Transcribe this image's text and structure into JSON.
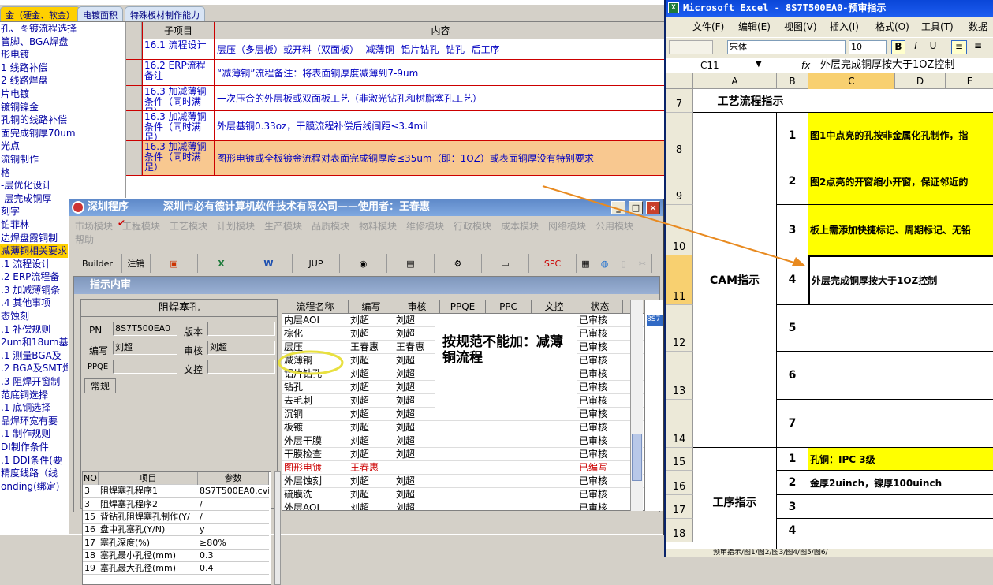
{
  "bg": {
    "tabs": [
      "金（硬金、软金）",
      "电镀面积",
      "特殊板材制作能力"
    ],
    "tree": [
      "孔、图镀流程选择",
      "管脚、BGA焊盘",
      "形电镀",
      "1 线路补偿",
      "2 线路焊盘",
      "片电镀",
      "镀铜镍金",
      "孔铜的线路补偿",
      "面完成铜厚70um",
      "光点",
      "流铜制作",
      "格",
      "-层优化设计",
      "-层完成铜厚",
      "刻字",
      "铂菲林",
      "边焊盘露铜制",
      "减薄铜相关要求",
      ".1 流程设计",
      ".2 ERP流程备",
      ".3 加减薄铜条",
      ".4 其他事项",
      "态蚀刻",
      ".1 补偿规则",
      "2um和18um基铜",
      ".1 测量BGA及",
      ".2 BGA及SMT焊",
      ".3 阻焊开窗制",
      "范底铜选择",
      ".1 底铜选择",
      "品焊环宽有要",
      ".1 制作规则",
      "DI制作条件",
      ".1 DDI条件(要",
      "精度线路（线",
      "onding(绑定)"
    ],
    "grid_header": {
      "c1": "子项目",
      "c2": "内容"
    },
    "grid_rows": [
      {
        "c1": "16.1 流程设计",
        "c2": "层压（多层板）或开料（双面板）--减薄铜--铝片钻孔--钻孔--后工序"
      },
      {
        "c1": "16.2 ERP流程备注",
        "c2": "“减薄铜”流程备注：将表面铜厚度减薄到7-9um"
      },
      {
        "c1": "16.3 加减薄铜条件（同时满足）",
        "c2": "一次压合的外层板或双面板工艺（非激光钻孔和树脂塞孔工艺）"
      },
      {
        "c1": "16.3 加减薄铜条件（同时满足）",
        "c2": "外层基铜0.33oz，干膜流程补偿后线间距≤3.4mil"
      },
      {
        "c1": "16.3 加减薄铜条件（同时满足）",
        "c2": "图形电镀或全板镀金流程对表面完成铜厚度≤35um（即：1OZ）或表面铜厚没有特别要求"
      }
    ]
  },
  "front": {
    "title": "深圳程序",
    "company": "深圳市必有德计算机软件技术有限公司——使用者：王春惠",
    "menu": [
      "市场模块",
      "工程模块",
      "工艺模块",
      "计划模块",
      "生产模块",
      "品质模块",
      "物料模块",
      "维修模块",
      "行政模块",
      "成本模块",
      "网络模块",
      "公用模块",
      "帮助"
    ],
    "toolbar": {
      "builder": "Builder",
      "logout": "注销",
      "jup": "JUP",
      "spc": "SPC"
    },
    "sub_title": "指示内审",
    "panel_title": "阻焊塞孔",
    "fields": {
      "pn_label": "PN",
      "pn": "8S7T500EA0",
      "ver_label": "版本",
      "ver": "",
      "editor_label": "编写",
      "editor": "刘超",
      "reviewer_label": "审核",
      "reviewer": "刘超",
      "pqe_label": "PPQE",
      "pqe": "",
      "doc_label": "文控",
      "doc": ""
    },
    "tab": "常规",
    "params_header": {
      "no": "NO",
      "item": "项目",
      "param": "参数"
    },
    "params": [
      {
        "no": "3",
        "item": "阻焊塞孔程序1",
        "param": "8S7T500EA0.cvi"
      },
      {
        "no": "3",
        "item": "阻焊塞孔程序2",
        "param": "/"
      },
      {
        "no": "15",
        "item": "背钻孔阻焊塞孔制作(Y/",
        "param": "/"
      },
      {
        "no": "16",
        "item": "盘中孔塞孔(Y/N)",
        "param": "y"
      },
      {
        "no": "17",
        "item": "塞孔深度(%)",
        "param": "≥80%"
      },
      {
        "no": "18",
        "item": "塞孔最小孔径(mm)",
        "param": "0.3"
      },
      {
        "no": "19",
        "item": "塞孔最大孔径(mm)",
        "param": "0.4"
      }
    ],
    "flow_header": [
      "流程名称",
      "编写",
      "审核",
      "PPQE",
      "PPC",
      "文控",
      "状态"
    ],
    "flows": [
      {
        "name": "内层AOI",
        "w": "刘超",
        "r": "刘超",
        "s": "已审核"
      },
      {
        "name": "棕化",
        "w": "刘超",
        "r": "刘超",
        "s": "已审核"
      },
      {
        "name": "层压",
        "w": "王春惠",
        "r": "王春惠",
        "s": "已审核"
      },
      {
        "name": "减薄铜",
        "w": "刘超",
        "r": "刘超",
        "s": "已审核"
      },
      {
        "name": "铝片钻孔",
        "w": "刘超",
        "r": "刘超",
        "s": "已审核"
      },
      {
        "name": "钻孔",
        "w": "刘超",
        "r": "刘超",
        "s": "已审核"
      },
      {
        "name": "去毛刺",
        "w": "刘超",
        "r": "刘超",
        "s": "已审核"
      },
      {
        "name": "沉铜",
        "w": "刘超",
        "r": "刘超",
        "s": "已审核"
      },
      {
        "name": "板镀",
        "w": "刘超",
        "r": "刘超",
        "s": "已审核"
      },
      {
        "name": "外层干膜",
        "w": "刘超",
        "r": "刘超",
        "s": "已审核"
      },
      {
        "name": "干膜检查",
        "w": "刘超",
        "r": "刘超",
        "s": "已审核"
      },
      {
        "name": "图形电镀",
        "w": "王春惠",
        "r": "",
        "s": "已编写",
        "red": true
      },
      {
        "name": "外层蚀刻",
        "w": "刘超",
        "r": "刘超",
        "s": "已审核"
      },
      {
        "name": "硫膜洗",
        "w": "刘超",
        "r": "刘超",
        "s": "已审核"
      },
      {
        "name": "外层AOI",
        "w": "刘超",
        "r": "刘超",
        "s": "已审核"
      }
    ],
    "annotation": "按规范不能加：减薄铜流程",
    "side_code": "8S7"
  },
  "excel": {
    "title": "Microsoft Excel - 8S7T500EA0-预审指示",
    "menu": [
      "文件(F)",
      "编辑(E)",
      "视图(V)",
      "插入(I)",
      "格式(O)",
      "工具(T)",
      "数据(D)"
    ],
    "font": "宋体",
    "size": "10",
    "cell_ref": "C11",
    "formula": "外层完成铜厚按大于1OZ控制",
    "cols": [
      "A",
      "B",
      "C",
      "D",
      "E"
    ],
    "rows": [
      "7",
      "8",
      "9",
      "10",
      "11",
      "12",
      "13",
      "14",
      "15",
      "16",
      "17",
      "18"
    ],
    "a7": "工艺流程指示",
    "cam": "CAM指示",
    "proc": "工序指示",
    "cam_items": [
      {
        "n": "1",
        "t": "图1中点亮的孔按非金属化孔制作，指"
      },
      {
        "n": "2",
        "t": "图2点亮的开窗缩小开窗，保证邻近的"
      },
      {
        "n": "3",
        "t": "板上需添加快捷标记、周期标记、无铅"
      },
      {
        "n": "4",
        "t": "外层完成铜厚按大于1OZ控制"
      },
      {
        "n": "5",
        "t": ""
      },
      {
        "n": "6",
        "t": ""
      },
      {
        "n": "7",
        "t": ""
      }
    ],
    "proc_items": [
      {
        "n": "1",
        "t": "孔铜：IPC 3级"
      },
      {
        "n": "2",
        "t": "金厚2uinch，镍厚100uinch"
      },
      {
        "n": "3",
        "t": ""
      },
      {
        "n": "4",
        "t": ""
      }
    ],
    "sheet_tabs": "预审指示/图1/图2/图3/图4/图5/图6/"
  },
  "colors": {
    "accent": "#0a46d8",
    "highlight": "#ffff00",
    "arrow": "#e88a20",
    "tree_sel": "#ffd000"
  }
}
